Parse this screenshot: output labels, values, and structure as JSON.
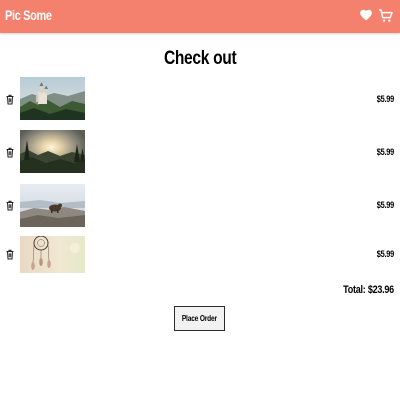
{
  "header": {
    "brand": "Pic Some",
    "color": "#f4806e",
    "icons": [
      "heart-icon",
      "cart-icon"
    ]
  },
  "checkout": {
    "title": "Check out",
    "items": [
      {
        "image": "castle-forest-photo",
        "price": "$5.99"
      },
      {
        "image": "sunset-forest-photo",
        "price": "$5.99"
      },
      {
        "image": "animal-on-rocks-photo",
        "price": "$5.99"
      },
      {
        "image": "dreamcatcher-photo",
        "price": "$5.99"
      }
    ],
    "total": "Total: $23.96",
    "place_order_label": "Place Order"
  }
}
